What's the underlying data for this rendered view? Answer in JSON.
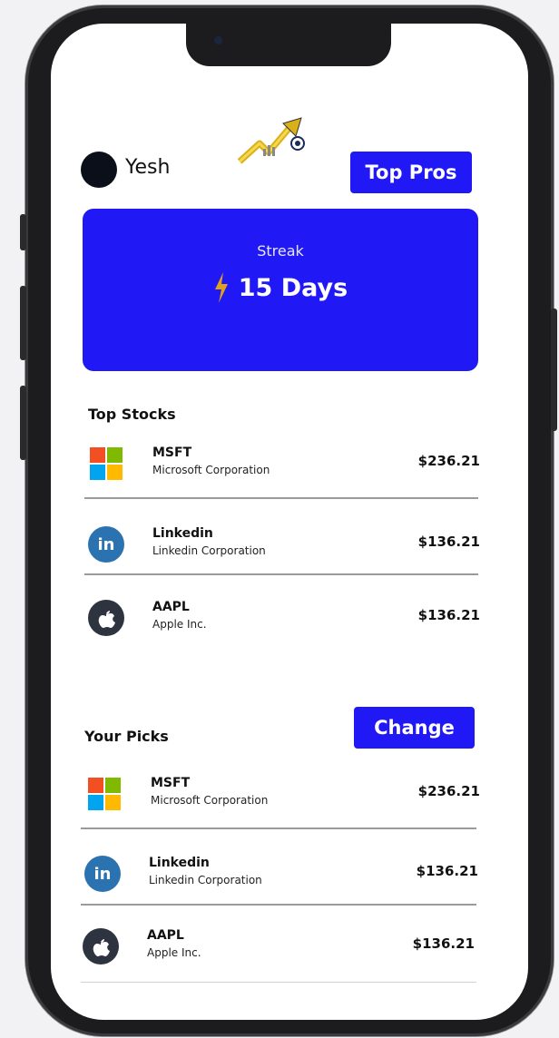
{
  "header": {
    "username": "Yesh",
    "top_pros_label": "Top Pros"
  },
  "streak": {
    "label": "Streak",
    "value": "15 Days"
  },
  "top_stocks": {
    "title": "Top Stocks",
    "items": [
      {
        "ticker": "MSFT",
        "company": "Microsoft Corporation",
        "price": "$236.21",
        "icon": "microsoft-icon"
      },
      {
        "ticker": "Linkedin",
        "company": "Linkedin Corporation",
        "price": "$136.21",
        "icon": "linkedin-icon"
      },
      {
        "ticker": "AAPL",
        "company": "Apple Inc.",
        "price": "$136.21",
        "icon": "apple-icon"
      }
    ]
  },
  "your_picks": {
    "title": "Your Picks",
    "change_label": "Change",
    "items": [
      {
        "ticker": "MSFT",
        "company": "Microsoft Corporation",
        "price": "$236.21",
        "icon": "microsoft-icon"
      },
      {
        "ticker": "Linkedin",
        "company": "Linkedin Corporation",
        "price": "$136.21",
        "icon": "linkedin-icon"
      },
      {
        "ticker": "AAPL",
        "company": "Apple Inc.",
        "price": "$136.21",
        "icon": "apple-icon"
      }
    ]
  },
  "icons": {
    "linkedin_glyph": "in"
  },
  "colors": {
    "accent": "#2119f5",
    "microsoft": [
      "#f25022",
      "#7fba00",
      "#00a4ef",
      "#ffb900"
    ],
    "linkedin": "#2a72b0",
    "apple": "#2e3340"
  }
}
